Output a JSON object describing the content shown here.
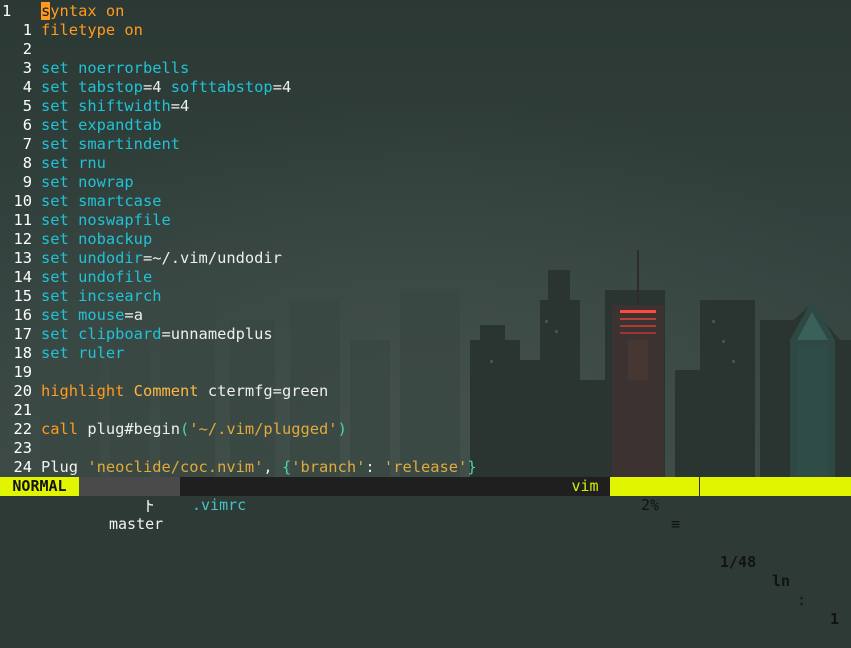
{
  "editor": {
    "current_line_number": "1",
    "lines": [
      {
        "n": "",
        "parts": [
          {
            "c": "cursor",
            "t": "s"
          },
          {
            "c": "cmd",
            "t": "yntax on"
          }
        ]
      },
      {
        "n": "1",
        "parts": [
          {
            "c": "cmd",
            "t": "filetype on"
          }
        ]
      },
      {
        "n": "2",
        "parts": []
      },
      {
        "n": "3",
        "parts": [
          {
            "c": "kw",
            "t": "set "
          },
          {
            "c": "kw",
            "t": "noerrorbells"
          }
        ]
      },
      {
        "n": "4",
        "parts": [
          {
            "c": "kw",
            "t": "set "
          },
          {
            "c": "kw",
            "t": "tabstop"
          },
          {
            "c": "id",
            "t": "=4 "
          },
          {
            "c": "kw",
            "t": "softtabstop"
          },
          {
            "c": "id",
            "t": "=4"
          }
        ]
      },
      {
        "n": "5",
        "parts": [
          {
            "c": "kw",
            "t": "set "
          },
          {
            "c": "kw",
            "t": "shiftwidth"
          },
          {
            "c": "id",
            "t": "=4"
          }
        ]
      },
      {
        "n": "6",
        "parts": [
          {
            "c": "kw",
            "t": "set "
          },
          {
            "c": "kw",
            "t": "expandtab"
          }
        ]
      },
      {
        "n": "7",
        "parts": [
          {
            "c": "kw",
            "t": "set "
          },
          {
            "c": "kw",
            "t": "smartindent"
          }
        ]
      },
      {
        "n": "8",
        "parts": [
          {
            "c": "kw",
            "t": "set "
          },
          {
            "c": "kw",
            "t": "rnu"
          }
        ]
      },
      {
        "n": "9",
        "parts": [
          {
            "c": "kw",
            "t": "set "
          },
          {
            "c": "kw",
            "t": "nowrap"
          }
        ]
      },
      {
        "n": "10",
        "parts": [
          {
            "c": "kw",
            "t": "set "
          },
          {
            "c": "kw",
            "t": "smartcase"
          }
        ]
      },
      {
        "n": "11",
        "parts": [
          {
            "c": "kw",
            "t": "set "
          },
          {
            "c": "kw",
            "t": "noswapfile"
          }
        ]
      },
      {
        "n": "12",
        "parts": [
          {
            "c": "kw",
            "t": "set "
          },
          {
            "c": "kw",
            "t": "nobackup"
          }
        ]
      },
      {
        "n": "13",
        "parts": [
          {
            "c": "kw",
            "t": "set "
          },
          {
            "c": "kw",
            "t": "undodir"
          },
          {
            "c": "id",
            "t": "=~/.vim/undodir"
          }
        ]
      },
      {
        "n": "14",
        "parts": [
          {
            "c": "kw",
            "t": "set "
          },
          {
            "c": "kw",
            "t": "undofile"
          }
        ]
      },
      {
        "n": "15",
        "parts": [
          {
            "c": "kw",
            "t": "set "
          },
          {
            "c": "kw",
            "t": "incsearch"
          }
        ]
      },
      {
        "n": "16",
        "parts": [
          {
            "c": "kw",
            "t": "set "
          },
          {
            "c": "kw",
            "t": "mouse"
          },
          {
            "c": "id",
            "t": "=a"
          }
        ]
      },
      {
        "n": "17",
        "parts": [
          {
            "c": "kw",
            "t": "set "
          },
          {
            "c": "kw",
            "t": "clipboard"
          },
          {
            "c": "id",
            "t": "=unnamedplus"
          }
        ]
      },
      {
        "n": "18",
        "parts": [
          {
            "c": "kw",
            "t": "set "
          },
          {
            "c": "kw",
            "t": "ruler"
          }
        ]
      },
      {
        "n": "19",
        "parts": []
      },
      {
        "n": "20",
        "parts": [
          {
            "c": "cmd",
            "t": "highlight "
          },
          {
            "c": "cmt",
            "t": "Comment "
          },
          {
            "c": "id",
            "t": "ctermfg=green"
          }
        ]
      },
      {
        "n": "21",
        "parts": []
      },
      {
        "n": "22",
        "parts": [
          {
            "c": "cmd",
            "t": "call "
          },
          {
            "c": "id",
            "t": "plug#begin"
          },
          {
            "c": "brace",
            "t": "("
          },
          {
            "c": "str",
            "t": "'~/.vim/plugged'"
          },
          {
            "c": "brace",
            "t": ")"
          }
        ]
      },
      {
        "n": "23",
        "parts": []
      },
      {
        "n": "24",
        "parts": [
          {
            "c": "id",
            "t": "Plug "
          },
          {
            "c": "str",
            "t": "'neoclide/coc.nvim'"
          },
          {
            "c": "id",
            "t": ", "
          },
          {
            "c": "brace",
            "t": "{"
          },
          {
            "c": "str",
            "t": "'branch'"
          },
          {
            "c": "id",
            "t": ": "
          },
          {
            "c": "str",
            "t": "'release'"
          },
          {
            "c": "brace",
            "t": "}"
          }
        ]
      }
    ]
  },
  "statusline": {
    "mode": "NORMAL",
    "branch_icon": "branch-icon",
    "branch": "master",
    "filename": ".vimrc",
    "filetype": "vim",
    "percent": "2%",
    "lines_glyph": "≡",
    "line_position": "1/48",
    "ln_label": "ln",
    "col_separator": ":",
    "column": "1"
  },
  "colors": {
    "keyword": "#21c2d6",
    "command": "#ff9b1e",
    "string": "#e0aa3c",
    "mode_bg": "#e2f500",
    "background": "#2d3a36"
  }
}
